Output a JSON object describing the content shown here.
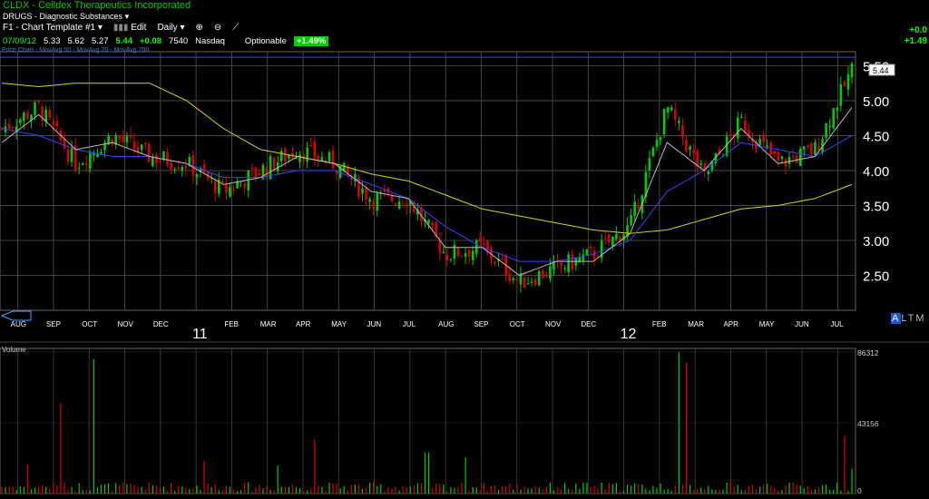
{
  "header": {
    "title": "CLDX - Celldex Therapeutics Incorporated",
    "sector": "DRUGS - Diagnostic Substances",
    "template": "F1 - Chart Template #1",
    "edit": "Edit",
    "period": "Daily",
    "quote": {
      "date": "07/09/12",
      "open": "5.33",
      "high": "5.62",
      "low": "5.27",
      "close": "5.44",
      "change": "+0.08",
      "volume": "7540",
      "exchange": "Nasdaq",
      "optionable": "Optionable",
      "pct": "+1.49%"
    },
    "right_change": "+0.0",
    "right_pct": "+1.49",
    "legend": "Price Chart - MovAvg 50 - MovAvg 20 - MovAvg 200",
    "volume_label": "Volume",
    "altm": [
      "A",
      "L",
      "T",
      "M"
    ]
  },
  "colors": {
    "up": "#00cc00",
    "down": "#dd0000",
    "ma50": "#3344ff",
    "ma20": "#bbbbbb",
    "ma200": "#d8d800"
  },
  "chart_data": [
    {
      "type": "candlestick",
      "title": "CLDX - Celldex Therapeutics Incorporated",
      "months": [
        "AUG",
        "SEP",
        "OCT",
        "NOV",
        "DEC",
        "11",
        "FEB",
        "MAR",
        "APR",
        "MAY",
        "JUN",
        "JUL",
        "AUG",
        "SEP",
        "OCT",
        "NOV",
        "DEC",
        "12",
        "FEB",
        "MAR",
        "APR",
        "MAY",
        "JUN",
        "JUL"
      ],
      "y_ticks": [
        "2.50",
        "3.00",
        "3.50",
        "4.00",
        "4.50",
        "5.00",
        "5.50"
      ],
      "ylim": [
        2.0,
        5.7
      ],
      "last_price": "5.44",
      "resistance": 5.62,
      "close_keypoints": [
        [
          0,
          4.6
        ],
        [
          1,
          4.9
        ],
        [
          2,
          4.1
        ],
        [
          3,
          4.5
        ],
        [
          4,
          4.2
        ],
        [
          5,
          4.1
        ],
        [
          6,
          3.7
        ],
        [
          7,
          4.0
        ],
        [
          8,
          4.3
        ],
        [
          9,
          4.1
        ],
        [
          10,
          3.6
        ],
        [
          11,
          3.6
        ],
        [
          12,
          2.8
        ],
        [
          13,
          2.9
        ],
        [
          14,
          2.4
        ],
        [
          15,
          2.6
        ],
        [
          16,
          2.8
        ],
        [
          17,
          3.2
        ],
        [
          18,
          4.9
        ],
        [
          19,
          3.9
        ],
        [
          20,
          4.7
        ],
        [
          21,
          4.1
        ],
        [
          22,
          4.3
        ],
        [
          23,
          5.44
        ]
      ],
      "ma20_keypoints": [
        [
          0,
          4.4
        ],
        [
          1,
          4.8
        ],
        [
          2,
          4.3
        ],
        [
          3,
          4.4
        ],
        [
          4,
          4.2
        ],
        [
          5,
          4.1
        ],
        [
          6,
          3.8
        ],
        [
          7,
          3.9
        ],
        [
          8,
          4.2
        ],
        [
          9,
          4.1
        ],
        [
          10,
          3.7
        ],
        [
          11,
          3.6
        ],
        [
          12,
          2.9
        ],
        [
          13,
          2.9
        ],
        [
          14,
          2.5
        ],
        [
          15,
          2.7
        ],
        [
          16,
          2.7
        ],
        [
          17,
          3.1
        ],
        [
          18,
          4.4
        ],
        [
          19,
          4.0
        ],
        [
          20,
          4.6
        ],
        [
          21,
          4.1
        ],
        [
          22,
          4.2
        ],
        [
          23,
          4.9
        ]
      ],
      "ma50_keypoints": [
        [
          0,
          4.6
        ],
        [
          1,
          4.5
        ],
        [
          2,
          4.3
        ],
        [
          3,
          4.2
        ],
        [
          4,
          4.2
        ],
        [
          5,
          4.1
        ],
        [
          6,
          3.9
        ],
        [
          7,
          3.9
        ],
        [
          8,
          4.0
        ],
        [
          9,
          4.0
        ],
        [
          10,
          3.8
        ],
        [
          11,
          3.6
        ],
        [
          12,
          3.2
        ],
        [
          13,
          2.9
        ],
        [
          14,
          2.7
        ],
        [
          15,
          2.7
        ],
        [
          16,
          2.8
        ],
        [
          17,
          3.0
        ],
        [
          18,
          3.7
        ],
        [
          19,
          4.0
        ],
        [
          20,
          4.4
        ],
        [
          21,
          4.3
        ],
        [
          22,
          4.2
        ],
        [
          23,
          4.5
        ]
      ],
      "ma200_keypoints": [
        [
          0,
          5.25
        ],
        [
          1,
          5.2
        ],
        [
          2,
          5.25
        ],
        [
          3,
          5.25
        ],
        [
          4,
          5.25
        ],
        [
          5,
          5.0
        ],
        [
          6,
          4.6
        ],
        [
          7,
          4.3
        ],
        [
          8,
          4.2
        ],
        [
          9,
          4.1
        ],
        [
          10,
          3.95
        ],
        [
          11,
          3.85
        ],
        [
          12,
          3.65
        ],
        [
          13,
          3.45
        ],
        [
          14,
          3.35
        ],
        [
          15,
          3.25
        ],
        [
          16,
          3.15
        ],
        [
          17,
          3.1
        ],
        [
          18,
          3.15
        ],
        [
          19,
          3.3
        ],
        [
          20,
          3.45
        ],
        [
          21,
          3.5
        ],
        [
          22,
          3.6
        ],
        [
          23,
          3.8
        ]
      ]
    },
    {
      "type": "bar",
      "title": "Volume",
      "y_ticks": [
        "0",
        "43156",
        "86312"
      ],
      "ylim": [
        0,
        86312
      ],
      "spikes": [
        [
          0.7,
          18000
        ],
        [
          1.6,
          55000
        ],
        [
          2.5,
          82000
        ],
        [
          5.5,
          20000
        ],
        [
          7.5,
          17000
        ],
        [
          8.5,
          33000
        ],
        [
          11.5,
          25000
        ],
        [
          12.5,
          22000
        ],
        [
          18.3,
          86312
        ],
        [
          18.5,
          80000
        ],
        [
          22.8,
          35000
        ],
        [
          23.0,
          15000
        ]
      ]
    }
  ]
}
